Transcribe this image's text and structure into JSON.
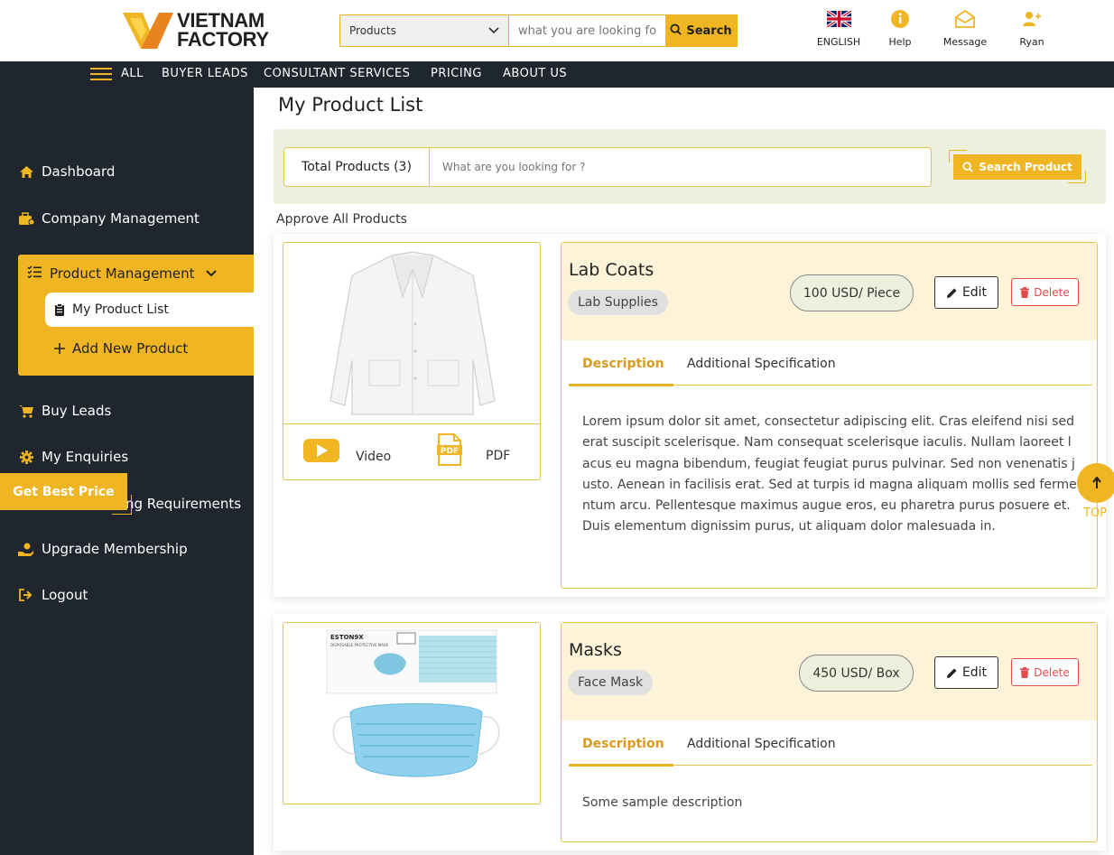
{
  "header": {
    "logo": {
      "line1": "VIETNAM",
      "line2": "FACTORY"
    },
    "search": {
      "category": "Products",
      "placeholder": "what you are looking for",
      "button_label": "Search"
    },
    "icons": [
      {
        "label": "ENGLISH",
        "icon": "uk-flag-icon"
      },
      {
        "label": "Help",
        "icon": "info-icon"
      },
      {
        "label": "Message",
        "icon": "envelope-icon"
      },
      {
        "label": "Ryan",
        "icon": "user-add-icon"
      }
    ]
  },
  "nav": {
    "items": [
      "ALL",
      "BUYER LEADS",
      "CONSULTANT SERVICES",
      "PRICING",
      "ABOUT US"
    ]
  },
  "sidebar": {
    "items": [
      {
        "label": "Dashboard",
        "icon": "home-icon"
      },
      {
        "label": "Company Management",
        "icon": "briefcase-icon"
      },
      {
        "label": "Buy Leads",
        "icon": "cart-icon"
      },
      {
        "label": "My Enquiries",
        "icon": "gear-icon"
      },
      {
        "label": "Sourcing Requirements",
        "visible_text": "ng Requirements",
        "icon": "list-icon"
      },
      {
        "label": "Upgrade Membership",
        "icon": "hand-coin-icon"
      },
      {
        "label": "Logout",
        "icon": "logout-icon"
      }
    ],
    "product_management": {
      "label": "Product Management",
      "sub_items": [
        {
          "label": "My Product List",
          "active": true
        },
        {
          "label": "Add New Product"
        }
      ]
    },
    "best_price_label": "Get Best Price"
  },
  "main": {
    "title": "My Product List",
    "total_products": "Total Products (3)",
    "search_placeholder": "What are you looking for ?",
    "search_button": "Search Product",
    "approve_all": "Approve All Products",
    "products": [
      {
        "name": "Lab Coats",
        "category": "Lab Supplies",
        "price": "100 USD/ Piece",
        "edit_label": "Edit",
        "delete_label": "Delete",
        "tabs": [
          "Description",
          "Additional Specification"
        ],
        "description": "Lorem ipsum dolor sit amet, consectetur adipiscing elit. Cras eleifend nisi sed erat suscipit scelerisque. Nam consequat scelerisque iaculis. Nullam laoreet lacus eu magna bibendum, feugiat feugiat purus pulvinar. Sed non venenatis justo. Aenean in facilisis erat. Sed at turpis id magna aliquam mollis sed fermentum arcu. Pellentesque maximus augue eros, eu pharetra purus posuere et. Duis elementum dignissim purus, ut aliquam dolor malesuada in.",
        "media": [
          {
            "label": "Video",
            "icon": "youtube-icon"
          },
          {
            "label": "PDF",
            "icon": "pdf-icon"
          }
        ]
      },
      {
        "name": "Masks",
        "category": "Face Mask",
        "price": "450 USD/ Box",
        "edit_label": "Edit",
        "delete_label": "Delete",
        "tabs": [
          "Description",
          "Additional Specification"
        ],
        "description": "Some sample description"
      }
    ]
  },
  "top_button": {
    "label": "TOP"
  },
  "colors": {
    "accent": "#f0b523",
    "dark": "#20262d",
    "danger": "#e34a4a",
    "panel": "#eef0de"
  }
}
